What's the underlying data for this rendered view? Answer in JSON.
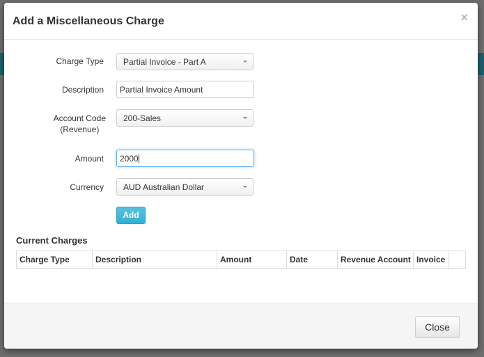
{
  "modal": {
    "title": "Add a Miscellaneous Charge",
    "close_icon": "×"
  },
  "form": {
    "charge_type": {
      "label": "Charge Type",
      "value": "Partial Invoice - Part A"
    },
    "description": {
      "label": "Description",
      "value": "Partial Invoice Amount"
    },
    "account_code": {
      "label_line1": "Account Code",
      "label_line2": "(Revenue)",
      "value": "200-Sales"
    },
    "amount": {
      "label": "Amount",
      "value": "2000"
    },
    "currency": {
      "label": "Currency",
      "value": "AUD Australian Dollar"
    },
    "add_label": "Add"
  },
  "current_charges": {
    "title": "Current Charges",
    "columns": [
      "Charge Type",
      "Description",
      "Amount",
      "Date",
      "Revenue Account",
      "Invoice",
      ""
    ]
  },
  "footer": {
    "close_label": "Close"
  },
  "colors": {
    "add_button": "#31b0d5",
    "background_band": "#1f5f6e"
  }
}
